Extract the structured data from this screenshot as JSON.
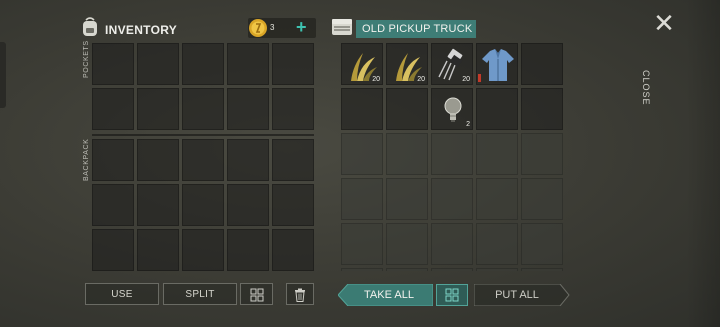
{
  "inventory": {
    "title": "INVENTORY",
    "coins": "3",
    "add_label": "+",
    "pockets_label": "POCKETS",
    "backpack_label": "BACKPACK"
  },
  "container": {
    "title": "OLD PICKUP TRUCK",
    "items": [
      {
        "name": "plant-fiber-icon",
        "qty": "20"
      },
      {
        "name": "plant-fiber-icon",
        "qty": "20"
      },
      {
        "name": "transistor-icon",
        "qty": "20"
      },
      {
        "name": "shirt-icon",
        "qty": ""
      },
      {
        "name": "light-bulb-icon",
        "qty": "2"
      }
    ]
  },
  "close": {
    "label": "CLOSE",
    "icon": "close-icon"
  },
  "buttons": {
    "use": "USE",
    "split": "SPLIT",
    "take_all": "TAKE ALL",
    "put_all": "PUT ALL"
  },
  "colors": {
    "accent": "#3e7d76",
    "accent_bright": "#3ec2b0",
    "durability": "#c23a2a"
  }
}
